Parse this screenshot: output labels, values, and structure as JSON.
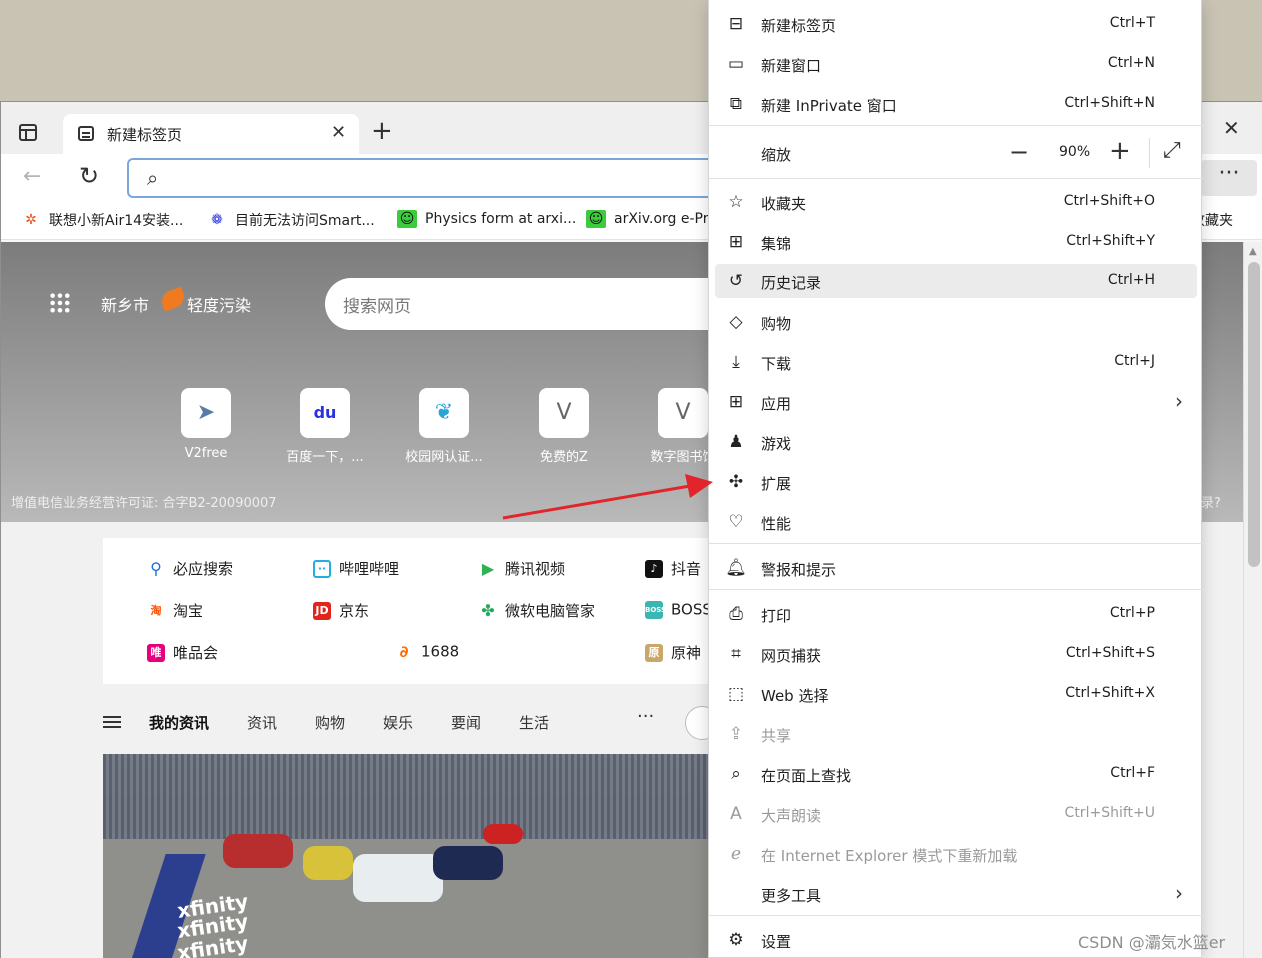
{
  "browser": {
    "tab_title": "新建标签页",
    "favorites": [
      {
        "icon": "ubuntu-icon",
        "label": "联想小新Air14安装..."
      },
      {
        "icon": "baidu-paw-icon",
        "label": "目前无法访问Smart..."
      },
      {
        "icon": "smiley-icon",
        "label": "Physics form at arxi..."
      },
      {
        "icon": "smiley-icon",
        "label": "arXiv.org e-Pri"
      }
    ],
    "favorites_folder": "收藏夹"
  },
  "ntp": {
    "weather_city": "新乡市",
    "weather_status": "轻度污染",
    "search_placeholder": "搜索网页",
    "quick_links": [
      {
        "label": "V2free",
        "icon": "paper-plane-icon",
        "glyph": "➤"
      },
      {
        "label": "百度一下，...",
        "icon": "baidu-icon",
        "glyph": "du"
      },
      {
        "label": "校园网认证...",
        "icon": "leaf-icon",
        "glyph": "❦"
      },
      {
        "label": "免费的Z",
        "icon": "v-icon",
        "glyph": "V"
      },
      {
        "label": "数字图书馆",
        "icon": "v-icon",
        "glyph": "V"
      }
    ],
    "license": "增值电信业务经营许可证: 合字B2-20090007",
    "hero_right_text": "录?",
    "shortcuts": [
      {
        "label": "必应搜索",
        "icon": "bing-search-icon",
        "color": "#1e6fd9"
      },
      {
        "label": "哔哩哔哩",
        "icon": "bilibili-icon",
        "color": "#23ade5"
      },
      {
        "label": "腾讯视频",
        "icon": "tencent-video-icon",
        "color": "#2fb24f"
      },
      {
        "label": "抖音",
        "icon": "douyin-icon",
        "color": "#111111"
      },
      {
        "label": "淘宝",
        "icon": "taobao-icon",
        "color": "#ff5000"
      },
      {
        "label": "京东",
        "icon": "jd-icon",
        "color": "#e1251b"
      },
      {
        "label": "微软电脑管家",
        "icon": "pc-manager-icon",
        "color": "#27a85e"
      },
      {
        "label": "BOSS",
        "icon": "boss-icon",
        "color": "#3bb6b0"
      },
      {
        "label": "唯品会",
        "icon": "vip-icon",
        "color": "#e5007f"
      },
      {
        "label": "1688",
        "icon": "1688-icon",
        "color": "#ff6a00"
      },
      {
        "label": "原神",
        "icon": "genshin-icon",
        "color": "#c9a76b"
      }
    ],
    "feed_tabs": [
      "我的资讯",
      "资讯",
      "购物",
      "娱乐",
      "要闻",
      "生活"
    ],
    "feed_more": "···",
    "image_text": [
      "xfinity",
      "xfinity",
      "xfinity"
    ]
  },
  "menu": {
    "items": [
      {
        "label": "新建标签页",
        "shortcut": "Ctrl+T",
        "icon": "new-tab-icon"
      },
      {
        "label": "新建窗口",
        "shortcut": "Ctrl+N",
        "icon": "new-window-icon"
      },
      {
        "label": "新建 InPrivate 窗口",
        "shortcut": "Ctrl+Shift+N",
        "icon": "inprivate-icon"
      },
      {
        "label": "收藏夹",
        "shortcut": "Ctrl+Shift+O",
        "icon": "favorites-icon"
      },
      {
        "label": "集锦",
        "shortcut": "Ctrl+Shift+Y",
        "icon": "collections-icon"
      },
      {
        "label": "历史记录",
        "shortcut": "Ctrl+H",
        "icon": "history-icon"
      },
      {
        "label": "购物",
        "shortcut": "",
        "icon": "shopping-tag-icon"
      },
      {
        "label": "下载",
        "shortcut": "Ctrl+J",
        "icon": "download-icon"
      },
      {
        "label": "应用",
        "shortcut": "",
        "icon": "apps-icon"
      },
      {
        "label": "游戏",
        "shortcut": "",
        "icon": "games-icon"
      },
      {
        "label": "扩展",
        "shortcut": "",
        "icon": "extensions-icon"
      },
      {
        "label": "性能",
        "shortcut": "",
        "icon": "performance-icon"
      },
      {
        "label": "警报和提示",
        "shortcut": "",
        "icon": "bell-icon"
      },
      {
        "label": "打印",
        "shortcut": "Ctrl+P",
        "icon": "print-icon"
      },
      {
        "label": "网页捕获",
        "shortcut": "Ctrl+Shift+S",
        "icon": "web-capture-icon"
      },
      {
        "label": "Web 选择",
        "shortcut": "Ctrl+Shift+X",
        "icon": "web-select-icon"
      },
      {
        "label": "共享",
        "shortcut": "",
        "icon": "share-icon"
      },
      {
        "label": "在页面上查找",
        "shortcut": "Ctrl+F",
        "icon": "find-icon"
      },
      {
        "label": "大声朗读",
        "shortcut": "Ctrl+Shift+U",
        "icon": "read-aloud-icon"
      },
      {
        "label": "在 Internet Explorer 模式下重新加载",
        "shortcut": "",
        "icon": "ie-mode-icon"
      },
      {
        "label": "更多工具",
        "shortcut": "",
        "icon": "more-tools-icon"
      },
      {
        "label": "设置",
        "shortcut": "",
        "icon": "settings-icon"
      }
    ],
    "zoom": {
      "label": "缩放",
      "value": "90%"
    }
  },
  "watermark": "CSDN @灞気水篮er",
  "colors": {
    "arrow": "#e0262b",
    "menu_highlight": "#ebebeb"
  }
}
